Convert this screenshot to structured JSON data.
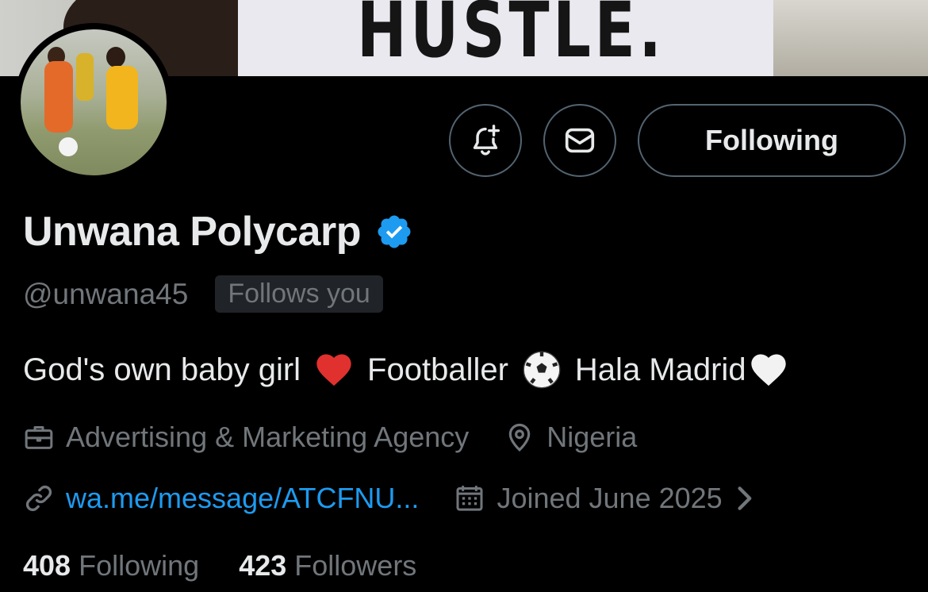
{
  "banner": {
    "shirt_text": "HUSTLE."
  },
  "actions": {
    "notify_icon": "bell-plus-icon",
    "message_icon": "envelope-icon",
    "follow_label": "Following"
  },
  "profile": {
    "name": "Unwana Polycarp",
    "verified_icon": "verified-badge-icon",
    "handle": "@unwana45",
    "follows_you": "Follows you",
    "bio": {
      "part1": "God's own baby girl",
      "part2": "Footballer",
      "part3": "Hala Madrid"
    },
    "category": "Advertising & Marketing Agency",
    "location": "Nigeria",
    "website": "wa.me/message/ATCFNU...",
    "joined": "Joined June 2025"
  },
  "stats": {
    "following_count": "408",
    "following_label": "Following",
    "followers_count": "423",
    "followers_label": "Followers"
  },
  "colors": {
    "background": "#000000",
    "text": "#e7e9ea",
    "muted": "#71767b",
    "link": "#1d9bf0",
    "verified": "#1d9bf0",
    "border": "#536471"
  }
}
